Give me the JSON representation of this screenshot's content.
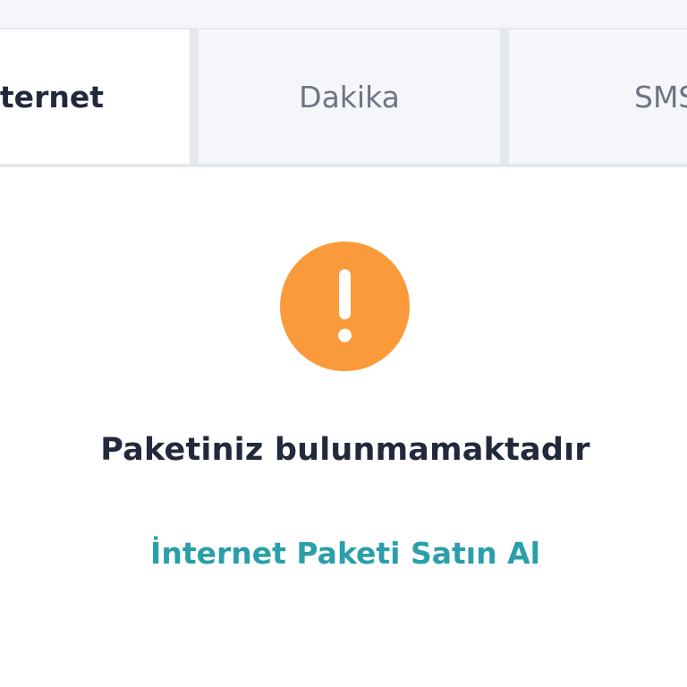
{
  "tabs": [
    {
      "label": "İnternet",
      "active": true
    },
    {
      "label": "Dakika",
      "active": false
    },
    {
      "label": "SMS",
      "active": false
    }
  ],
  "empty_state": {
    "icon": "exclamation-icon",
    "icon_color": "#fb9a3a",
    "message": "Paketiniz bulunmamaktadır",
    "action_label": "İnternet Paketi Satın Al",
    "action_color": "#2a9fa9"
  }
}
